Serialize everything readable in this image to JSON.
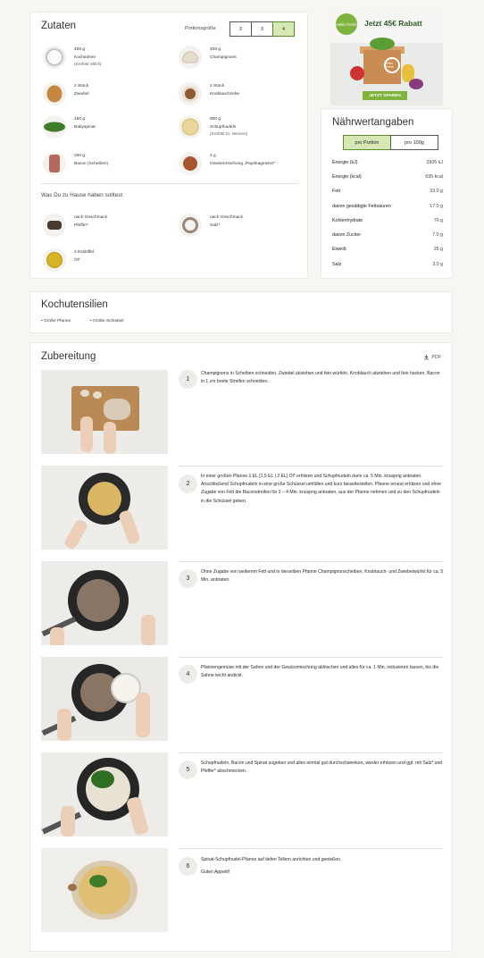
{
  "ingredients": {
    "title": "Zutaten",
    "portion_label": "Portionsgröße",
    "portions": [
      "2",
      "3",
      "4"
    ],
    "selected_portion": "4",
    "items": [
      {
        "amount": "400 g",
        "name": "Kochsahne",
        "note": "(Enthält Milch)",
        "icon": "cream-icon"
      },
      {
        "amount": "400 g",
        "name": "Champignons",
        "note": "",
        "icon": "mushroom-icon"
      },
      {
        "amount": "2 Stück",
        "name": "Zwiebel",
        "note": "",
        "icon": "onion-icon"
      },
      {
        "amount": "2 Stück",
        "name": "Knoblauchzehe",
        "note": "",
        "icon": "garlic-icon"
      },
      {
        "amount": "150 g",
        "name": "Babyspinat",
        "note": "",
        "icon": "spinach-icon"
      },
      {
        "amount": "800 g",
        "name": "Schupfnudeln",
        "note": "(Enthält Ei, Weizen)",
        "icon": "schupfnudeln-icon"
      },
      {
        "amount": "200 g",
        "name": "Bacon (Scheiben)",
        "note": "",
        "icon": "bacon-icon"
      },
      {
        "amount": "4 g",
        "name": "Gewürzmischung „Paprikagewürz“",
        "note": "",
        "icon": "spice-icon"
      }
    ],
    "home_title": "Was Du zu Hause haben solltest",
    "home_items": [
      {
        "amount": "nach Geschmack",
        "name": "Pfeffer*",
        "icon": "pepper-icon"
      },
      {
        "amount": "nach Geschmack",
        "name": "Salz*",
        "icon": "salt-icon"
      },
      {
        "amount": "2 Esslöffel",
        "name": "Öl*",
        "icon": "oil-icon"
      }
    ]
  },
  "ad": {
    "logo": "Hello Fresh",
    "headline": "Jetzt 45€ Rabatt",
    "cta": "JETZT SPAREN",
    "badge": "Hello Fresh"
  },
  "nutrition": {
    "title": "Nährwertangaben",
    "tabs": [
      "pro Portion",
      "pro 100g"
    ],
    "active_tab": "pro Portion",
    "rows": [
      {
        "label": "Energie (kJ)",
        "value": "2905 kJ"
      },
      {
        "label": "Energie (kcal)",
        "value": "695 kcal"
      },
      {
        "label": "Fett",
        "value": "33.0 g"
      },
      {
        "label": "davon gesättigte Fettsäuren",
        "value": "17.0 g"
      },
      {
        "label": "Kohlenhydrate",
        "value": "70 g"
      },
      {
        "label": "davon Zucker",
        "value": "7.0 g"
      },
      {
        "label": "Eiweiß",
        "value": "25 g"
      },
      {
        "label": "Salz",
        "value": "3.0 g"
      }
    ]
  },
  "tools": {
    "title": "Kochutensilien",
    "items": [
      "• Große Pfanne",
      "• Große Schüssel"
    ]
  },
  "preparation": {
    "title": "Zubereitung",
    "pdf_label": "PDF",
    "steps": [
      {
        "num": "1",
        "text": "Champignons in Scheiben schneiden. Zwiebel abziehen und fein würfeln. Knoblauch abziehen und fein hacken. Bacon in 1 cm breite Streifen schneiden.",
        "extra": ""
      },
      {
        "num": "2",
        "text": "In einer großen Pfanne 1 EL [1,5 EL | 2 EL] Öl* erhitzen und Schupfnudeln darin ca. 5 Min. knusprig anbraten. Anschließend Schupfnudeln in eine große Schüssel umfüllen und kurz beiseitestellen. Pfanne erneut erhitzen und ohne Zugabe von Fett die Baconstreifen für 3 – 4 Min. knusprig anbraten, aus der Pfanne nehmen und zu den Schupfnudeln in die Schüssel geben.",
        "extra": ""
      },
      {
        "num": "3",
        "text": "Ohne Zugabe von weiterem Fett und in derselben Pfanne Champignonscheiben, Knoblauch- und Zwiebelwürfel für ca. 5 Min. anbraten.",
        "extra": ""
      },
      {
        "num": "4",
        "text": "Pfannengemüse mit der Sahne und der Gewürzmischung ablöschen und alles für ca. 1 Min. reduzieren lassen, bis die Sahne leicht andickt.",
        "extra": ""
      },
      {
        "num": "5",
        "text": "Schupfnudeln, Bacon und Spinat zugeben und alles einmal gut durchschwenken, wieder erhitzen und ggf. mit Salz* und Pfeffer* abschmecken.",
        "extra": ""
      },
      {
        "num": "6",
        "text": "Spinat-Schupfnudel-Pfanne auf tiefen Tellern anrichten und genießen.",
        "extra": "Guten Appetit!"
      }
    ]
  }
}
